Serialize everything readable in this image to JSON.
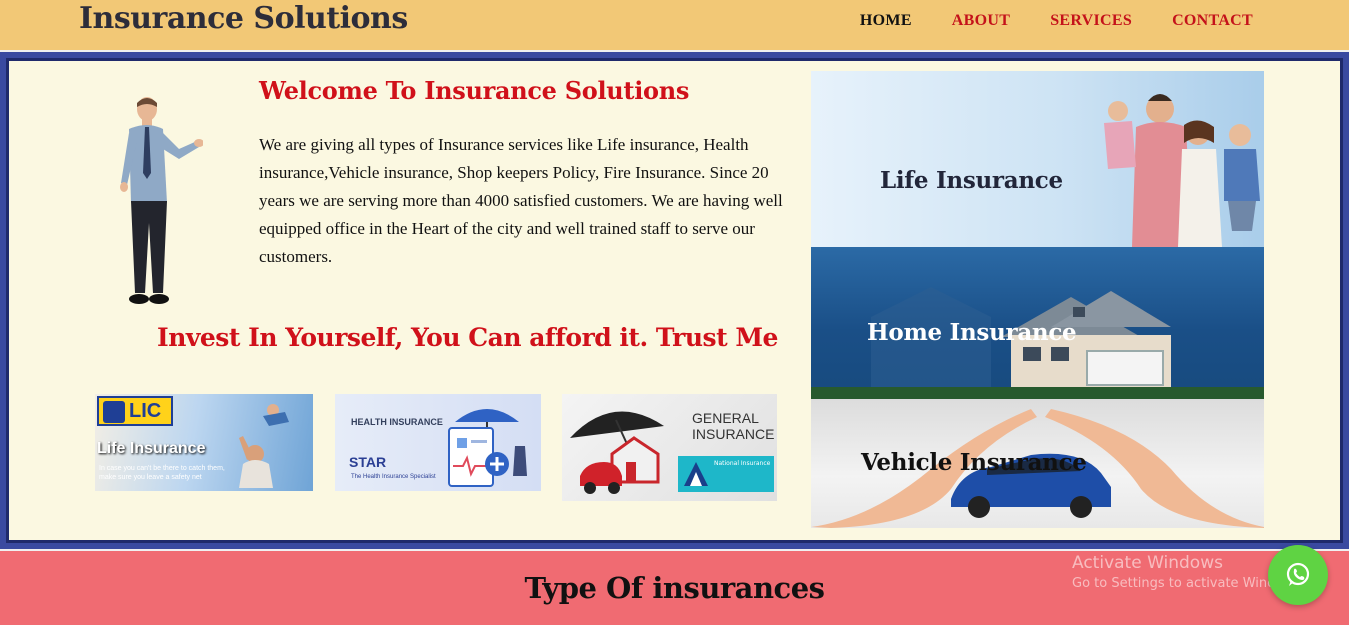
{
  "header": {
    "brand": "Insurance Solutions",
    "nav": [
      "HOME",
      "ABOUT",
      "SERVICES",
      "CONTACT"
    ],
    "active_nav": "HOME"
  },
  "main": {
    "welcome_title": "Welcome To Insurance Solutions",
    "about_text": "We are giving all types of Insurance services like Life insurance, Health insurance,Vehicle insurance, Shop keepers Policy, Fire Insurance. Since 20 years we are serving more than 4000 satisfied customers. We are having well equipped office in the Heart of the city and well trained staff to serve our customers.",
    "tagline": "Invest In Yourself, You Can afford it. Trust Me",
    "partners": {
      "lic": {
        "logo": "LIC",
        "title": "Life Insurance",
        "sub": "In case you can't be there to catch them, make sure you leave a safety net"
      },
      "health": {
        "title": "HEALTH INSURANCE",
        "brand": "STAR",
        "sub": "The Health Insurance Specialist"
      },
      "general": {
        "title": "GENERAL INSURANCE",
        "logo_text": "National Insurance"
      }
    }
  },
  "cards": {
    "life": "Life Insurance",
    "home": "Home Insurance",
    "vehicle": "Vehicle Insurance"
  },
  "section": {
    "title": "Type Of insurances"
  },
  "overlay": {
    "watermark_line1": "Activate Windows",
    "watermark_line2": "Go to Settings to activate Windows."
  },
  "colors": {
    "header_bg": "#f2c876",
    "nav_red": "#c4121a",
    "accent_red": "#d0111a",
    "frame_blue": "#3a4aa0",
    "panel_bg": "#fbf8e1",
    "band_bg": "#f06b72",
    "whatsapp_green": "#5fd343"
  },
  "icons": {
    "whatsapp": "whatsapp-icon"
  }
}
